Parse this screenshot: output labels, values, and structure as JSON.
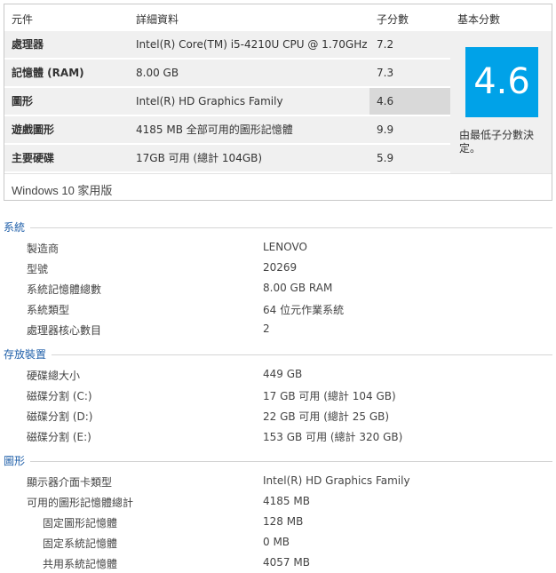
{
  "score_table": {
    "headers": {
      "component": "元件",
      "details": "詳細資料",
      "subscore": "子分數",
      "base_score": "基本分數"
    },
    "rows": [
      {
        "component": "處理器",
        "details": "Intel(R) Core(TM) i5-4210U CPU @ 1.70GHz",
        "subscore": "7.2"
      },
      {
        "component": "記憶體 (RAM)",
        "details": "8.00 GB",
        "subscore": "7.3"
      },
      {
        "component": "圖形",
        "details": "Intel(R) HD Graphics Family",
        "subscore": "4.6"
      },
      {
        "component": "遊戲圖形",
        "details": "4185 MB 全部可用的圖形記憶體",
        "subscore": "9.9"
      },
      {
        "component": "主要硬碟",
        "details": "17GB 可用 (總計 104GB)",
        "subscore": "5.9"
      }
    ],
    "base_score_value": "4.6",
    "base_score_note": "由最低子分數決定。",
    "os_edition": "Windows 10 家用版",
    "colors": {
      "accent": "#00a2e8",
      "lowest_row_highlight": "#d9d9d9"
    }
  },
  "system": {
    "title": "系統",
    "items": [
      {
        "label": "製造商",
        "value": "LENOVO"
      },
      {
        "label": "型號",
        "value": "20269"
      },
      {
        "label": "系統記憶體總數",
        "value": "8.00 GB RAM"
      },
      {
        "label": "系統類型",
        "value": "64 位元作業系統"
      },
      {
        "label": "處理器核心數目",
        "value": "2"
      }
    ]
  },
  "storage": {
    "title": "存放裝置",
    "items": [
      {
        "label": "硬碟總大小",
        "value": "449 GB"
      },
      {
        "label": "磁碟分割 (C:)",
        "value": "17 GB 可用 (總計 104 GB)"
      },
      {
        "label": "磁碟分割 (D:)",
        "value": "22 GB 可用 (總計 25 GB)"
      },
      {
        "label": "磁碟分割 (E:)",
        "value": "153 GB 可用 (總計 320 GB)"
      }
    ]
  },
  "graphics": {
    "title": "圖形",
    "items": [
      {
        "label": "顯示器介面卡類型",
        "value": "Intel(R) HD Graphics Family"
      },
      {
        "label": "可用的圖形記憶體總計",
        "value": "4185 MB"
      },
      {
        "label": "固定圖形記憶體",
        "value": "128 MB"
      },
      {
        "label": "固定系統記憶體",
        "value": "0 MB"
      },
      {
        "label": "共用系統記憶體",
        "value": "4057 MB"
      }
    ]
  }
}
